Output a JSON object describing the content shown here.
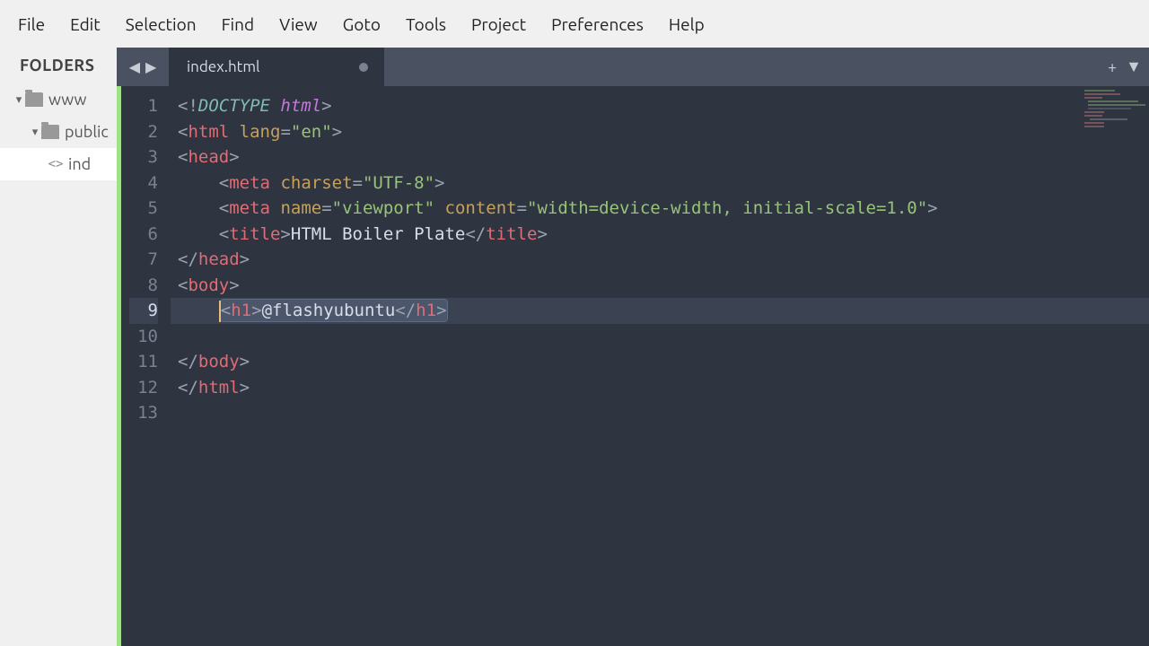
{
  "menu": {
    "items": [
      "File",
      "Edit",
      "Selection",
      "Find",
      "View",
      "Goto",
      "Tools",
      "Project",
      "Preferences",
      "Help"
    ]
  },
  "sidebar": {
    "header": "FOLDERS",
    "tree": {
      "root": "www",
      "child": "public",
      "file": "index.html",
      "file_display": "ind"
    }
  },
  "tab": {
    "title": "index.html",
    "dirty": true
  },
  "code": {
    "lines": [
      {
        "n": 1,
        "indent": 0,
        "tokens": [
          [
            "punct",
            "<!"
          ],
          [
            "doct",
            "DOCTYPE "
          ],
          [
            "doct-kw",
            "html"
          ],
          [
            "punct",
            ">"
          ]
        ]
      },
      {
        "n": 2,
        "indent": 0,
        "tokens": [
          [
            "punct",
            "<"
          ],
          [
            "tag",
            "html"
          ],
          [
            "text",
            " "
          ],
          [
            "attr",
            "lang"
          ],
          [
            "punct",
            "="
          ],
          [
            "string",
            "\"en\""
          ],
          [
            "punct",
            ">"
          ]
        ]
      },
      {
        "n": 3,
        "indent": 0,
        "tokens": [
          [
            "punct",
            "<"
          ],
          [
            "tag",
            "head"
          ],
          [
            "punct",
            ">"
          ]
        ]
      },
      {
        "n": 4,
        "indent": 1,
        "tokens": [
          [
            "punct",
            "<"
          ],
          [
            "tag",
            "meta"
          ],
          [
            "text",
            " "
          ],
          [
            "attr",
            "charset"
          ],
          [
            "punct",
            "="
          ],
          [
            "string",
            "\"UTF-8\""
          ],
          [
            "punct",
            ">"
          ]
        ]
      },
      {
        "n": 5,
        "indent": 1,
        "tokens": [
          [
            "punct",
            "<"
          ],
          [
            "tag",
            "meta"
          ],
          [
            "text",
            " "
          ],
          [
            "attr",
            "name"
          ],
          [
            "punct",
            "="
          ],
          [
            "string",
            "\"viewport\""
          ],
          [
            "text",
            " "
          ],
          [
            "attr",
            "content"
          ],
          [
            "punct",
            "="
          ],
          [
            "string",
            "\"width=device-width, initial-scale=1.0\""
          ],
          [
            "punct",
            ">"
          ]
        ]
      },
      {
        "n": 6,
        "indent": 1,
        "tokens": [
          [
            "punct",
            "<"
          ],
          [
            "tag",
            "title"
          ],
          [
            "punct",
            ">"
          ],
          [
            "text",
            "HTML Boiler Plate"
          ],
          [
            "punct",
            "</"
          ],
          [
            "tag",
            "title"
          ],
          [
            "punct",
            ">"
          ]
        ]
      },
      {
        "n": 7,
        "indent": 0,
        "tokens": [
          [
            "punct",
            "</"
          ],
          [
            "tag",
            "head"
          ],
          [
            "punct",
            ">"
          ]
        ]
      },
      {
        "n": 8,
        "indent": 0,
        "tokens": [
          [
            "punct",
            "<"
          ],
          [
            "tag",
            "body"
          ],
          [
            "punct",
            ">"
          ]
        ]
      },
      {
        "n": 9,
        "indent": 1,
        "tokens": [
          [
            "punct",
            "<"
          ],
          [
            "tag",
            "h1"
          ],
          [
            "punct",
            ">"
          ],
          [
            "text",
            "@flashyubuntu"
          ],
          [
            "punct",
            "</"
          ],
          [
            "tag",
            "h1"
          ],
          [
            "punct",
            ">"
          ]
        ],
        "selected": true,
        "active": true
      },
      {
        "n": 10,
        "indent": 1,
        "tokens": []
      },
      {
        "n": 11,
        "indent": 0,
        "tokens": [
          [
            "punct",
            "</"
          ],
          [
            "tag",
            "body"
          ],
          [
            "punct",
            ">"
          ]
        ]
      },
      {
        "n": 12,
        "indent": 0,
        "tokens": [
          [
            "punct",
            "</"
          ],
          [
            "tag",
            "html"
          ],
          [
            "punct",
            ">"
          ]
        ]
      },
      {
        "n": 13,
        "indent": 0,
        "tokens": []
      }
    ]
  }
}
